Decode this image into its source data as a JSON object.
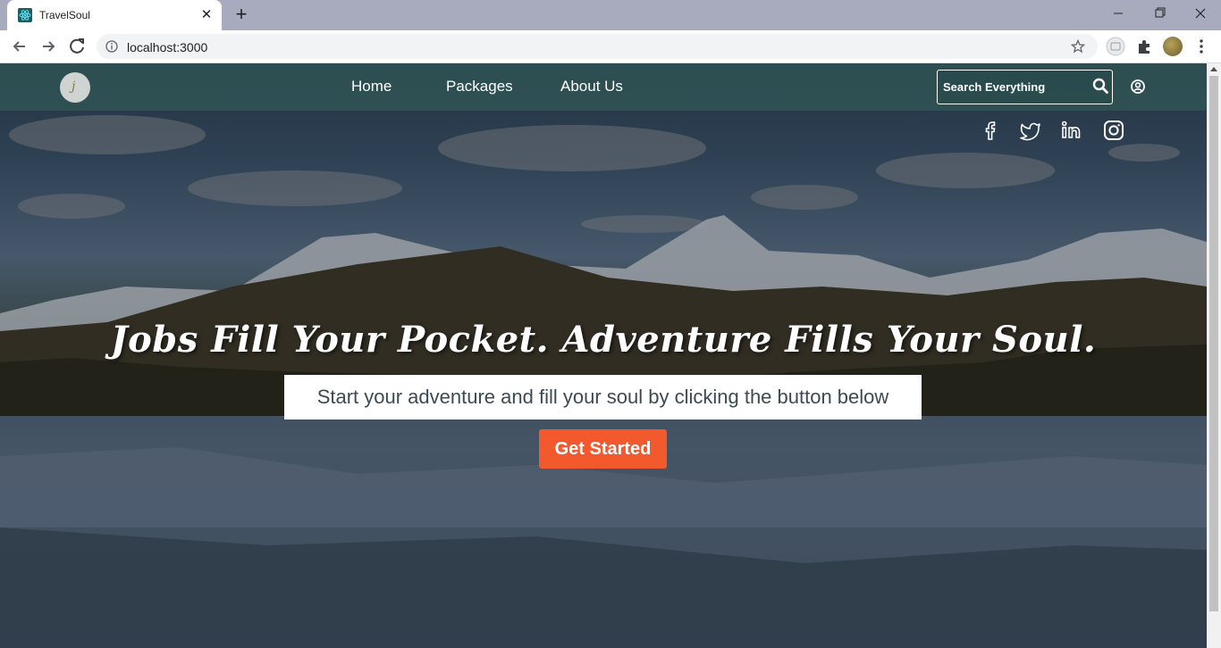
{
  "browser": {
    "tab_title": "TravelSoul",
    "tab_close": "✕",
    "new_tab": "+",
    "url": "localhost:3000"
  },
  "site": {
    "nav": {
      "home": "Home",
      "packages": "Packages",
      "about": "About Us"
    },
    "search_placeholder": "Search Everything",
    "hero": {
      "headline": "Jobs Fill Your Pocket. Adventure Fills Your Soul.",
      "tagline": "Start your adventure and fill your soul by clicking the button below",
      "cta": "Get Started"
    },
    "social_icons": [
      "facebook-icon",
      "twitter-icon",
      "linkedin-icon",
      "instagram-icon"
    ],
    "colors": {
      "navbar": "#305656",
      "cta": "#f2592d"
    }
  }
}
